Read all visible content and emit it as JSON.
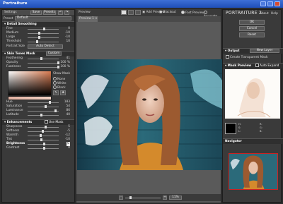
{
  "window": {
    "title": "Portraiture"
  },
  "left": {
    "header": {
      "settings": "Settings",
      "save": "Save",
      "presets": "Presets"
    },
    "preset": {
      "label": "Preset",
      "value": "Default"
    },
    "detail": {
      "title": "Detail Smoothing",
      "rows": [
        {
          "label": "Fine",
          "value": "0"
        },
        {
          "label": "Medium",
          "value": "-10"
        },
        {
          "label": "Large",
          "value": "-10"
        },
        {
          "label": "Threshold",
          "value": "10"
        }
      ],
      "portrait_size_label": "Portrait Size",
      "portrait_size_value": "Auto Detect"
    },
    "skin": {
      "title": "Skin Tones Mask",
      "mode": "Custom",
      "rows": [
        {
          "label": "Feathering",
          "value": "41"
        },
        {
          "label": "Opacity",
          "value": "100 %"
        },
        {
          "label": "Fuzziness",
          "value": "100 %"
        }
      ],
      "show_mask": "Show Mask",
      "options": [
        "None",
        "White",
        "Black"
      ],
      "hsl": [
        {
          "label": "Hue",
          "value": "183"
        },
        {
          "label": "Saturation",
          "value": "54"
        },
        {
          "label": "Luminance",
          "value": "86"
        },
        {
          "label": "Latitude",
          "value": "40"
        }
      ]
    },
    "enh": {
      "title": "Enhancements",
      "use_mask": "Use Mask",
      "rows": [
        {
          "label": "Sharpness",
          "value": "5"
        },
        {
          "label": "Softness",
          "value": "-5"
        },
        {
          "label": "Warmth",
          "value": "-12"
        },
        {
          "label": "Tint",
          "value": "-10"
        },
        {
          "label": "Brightness",
          "value": "0"
        },
        {
          "label": "Contrast",
          "value": "0"
        }
      ]
    }
  },
  "center": {
    "toolbar": {
      "preview": "Preview",
      "add_preview": "Add Preview",
      "blackout": "Blackout",
      "fast": "Fast Preview",
      "accurate": "Accurate"
    },
    "tab": "Preview 1",
    "zoom": "11%"
  },
  "right": {
    "logo": "PORTRAITURE 2",
    "about": "About",
    "help": "Help",
    "ok": "OK",
    "cancel": "Cancel",
    "reset": "Reset",
    "output": {
      "label": "Output",
      "value": "New Layer",
      "transparent": "Create Transparent Mask"
    },
    "mask": {
      "title": "Mask Preview",
      "auto": "Auto Expand",
      "channels": [
        "H:",
        "S:",
        "L:",
        "R:",
        "G:",
        "B:"
      ]
    },
    "navigator": "Navigator"
  }
}
